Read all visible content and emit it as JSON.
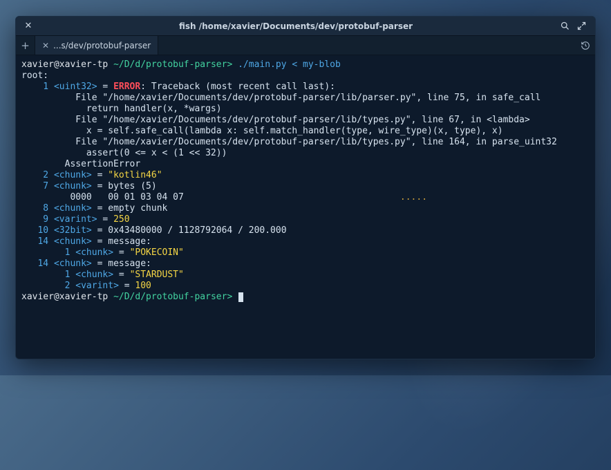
{
  "window": {
    "title": "fish  /home/xavier/Documents/dev/protobuf-parser"
  },
  "tab": {
    "label": "...s/dev/protobuf-parser"
  },
  "prompt": {
    "user_host": "xavier@xavier-tp",
    "path": "~/D/d/protobuf-parser",
    "symbol": ">"
  },
  "command": "./main.py < my-blob",
  "output": {
    "root_label": "root:",
    "lines": [
      {
        "field": "1",
        "type": "<uint32>",
        "op": "=",
        "kind": "error",
        "error_label": "ERROR",
        "error_intro": ": Traceback (most recent call last):",
        "trace": [
          "  File \"/home/xavier/Documents/dev/protobuf-parser/lib/parser.py\", line 75, in safe_call",
          "    return handler(x, *wargs)",
          "  File \"/home/xavier/Documents/dev/protobuf-parser/lib/types.py\", line 67, in <lambda>",
          "    x = self.safe_call(lambda x: self.match_handler(type, wire_type)(x, type), x)",
          "  File \"/home/xavier/Documents/dev/protobuf-parser/lib/types.py\", line 164, in parse_uint32",
          "    assert(0 <= x < (1 << 32))",
          "AssertionError"
        ]
      },
      {
        "field": "2",
        "type": "<chunk>",
        "op": "=",
        "kind": "string",
        "value": "\"kotlin46\""
      },
      {
        "field": "7",
        "type": "<chunk>",
        "op": "=",
        "kind": "bytes",
        "desc": "bytes (5)",
        "hex_offset": "0000",
        "hex_bytes": "00 01 03 04 07",
        "hex_ascii": "....."
      },
      {
        "field": "8",
        "type": "<chunk>",
        "op": "=",
        "kind": "plain",
        "value": "empty chunk"
      },
      {
        "field": "9",
        "type": "<varint>",
        "op": "=",
        "kind": "string",
        "value": "250"
      },
      {
        "field": "10",
        "type": "<32bit>",
        "op": "=",
        "kind": "plain",
        "value": "0x43480000 / 1128792064 / 200.000"
      },
      {
        "field": "14",
        "type": "<chunk>",
        "op": "=",
        "kind": "message",
        "value": "message:",
        "children": [
          {
            "field": "1",
            "type": "<chunk>",
            "op": "=",
            "kind": "string",
            "value": "\"POKECOIN\""
          }
        ]
      },
      {
        "field": "14",
        "type": "<chunk>",
        "op": "=",
        "kind": "message",
        "value": "message:",
        "children": [
          {
            "field": "1",
            "type": "<chunk>",
            "op": "=",
            "kind": "string",
            "value": "\"STARDUST\""
          },
          {
            "field": "2",
            "type": "<varint>",
            "op": "=",
            "kind": "string",
            "value": "100"
          }
        ]
      }
    ]
  }
}
